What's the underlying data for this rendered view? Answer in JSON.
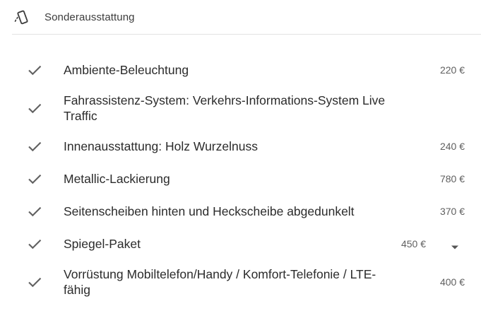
{
  "header": {
    "title": "Sonderausstattung",
    "icon": "phone-tilt-icon"
  },
  "items": [
    {
      "label": "Ambiente-Beleuchtung",
      "price": "220 €",
      "checked": true
    },
    {
      "label": "Fahrassistenz-System: Verkehrs-Informations-System Live Traffic",
      "price": "",
      "checked": true
    },
    {
      "label": "Innenausstattung: Holz Wurzelnuss",
      "price": "240 €",
      "checked": true
    },
    {
      "label": "Metallic-Lackierung",
      "price": "780 €",
      "checked": true
    },
    {
      "label": "Seitenscheiben hinten und Heckscheibe abgedunkelt",
      "price": "370 €",
      "checked": true
    },
    {
      "label": "Spiegel-Paket",
      "price": "450 €",
      "checked": true,
      "expandable": true
    },
    {
      "label": "Vorrüstung Mobiltelefon/Handy / Komfort-Telefonie / LTE-fähig",
      "price": "400 €",
      "checked": true
    }
  ],
  "colors": {
    "text": "#2b2b2b",
    "muted": "#5f5f5f",
    "icon": "#616161",
    "divider": "#e3e3e3"
  }
}
